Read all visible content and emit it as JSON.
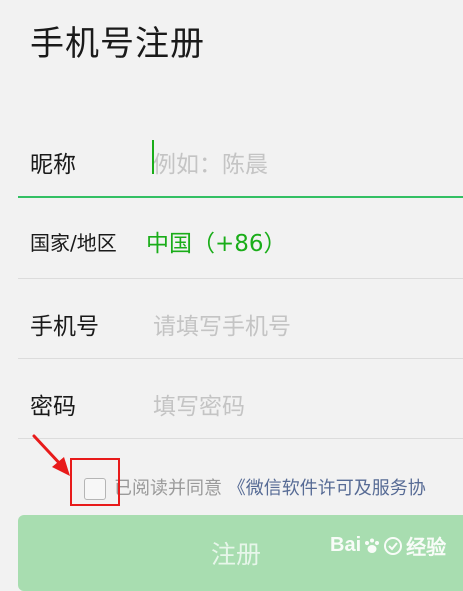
{
  "page": {
    "title": "手机号注册"
  },
  "form": {
    "nickname": {
      "label": "昵称",
      "placeholder": "例如：陈晨"
    },
    "region": {
      "label": "国家/地区",
      "value": "中国（+86）"
    },
    "phone": {
      "label": "手机号",
      "placeholder": "请填写手机号"
    },
    "password": {
      "label": "密码",
      "placeholder": "填写密码"
    }
  },
  "agreement": {
    "prefix": "已阅读并同意",
    "link": "《微信软件许可及服务协"
  },
  "button": {
    "register_label": "注册"
  },
  "watermark": {
    "text_a": "Bai",
    "text_b": "经验"
  },
  "colors": {
    "accent": "#1aad19",
    "link": "#576b95",
    "button_disabled": "#a8ddb0",
    "highlight": "#e81b1b"
  }
}
